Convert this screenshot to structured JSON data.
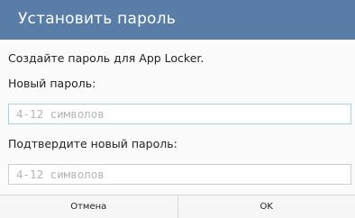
{
  "dialog": {
    "title": "Установить пароль",
    "description": "Создайте пароль для App Locker.",
    "new_password": {
      "label": "Новый пароль:",
      "placeholder": "4-12 символов",
      "value": ""
    },
    "confirm_password": {
      "label": "Подтвердите новый пароль:",
      "placeholder": "4-12 символов",
      "value": ""
    },
    "buttons": {
      "cancel": "Отмена",
      "ok": "OK"
    }
  },
  "colors": {
    "title_bar": "#5a7da7",
    "title_text": "#ffffff",
    "focused_border": "#a8cfe0"
  }
}
